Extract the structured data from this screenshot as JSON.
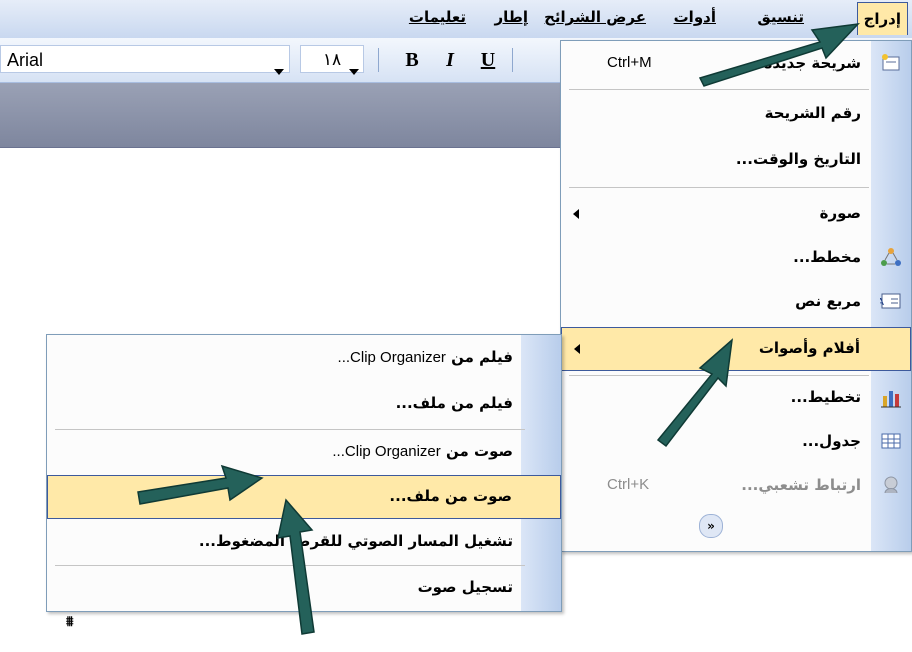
{
  "menubar": {
    "items": [
      {
        "label": "إدراج",
        "active": true
      },
      {
        "label": "تنسيق"
      },
      {
        "label": "أدوات"
      },
      {
        "label": "عرض الشرائح"
      },
      {
        "label": "إطار"
      },
      {
        "label": "تعليمات"
      }
    ]
  },
  "toolbar": {
    "font_name": "Arial",
    "font_size": "١٨",
    "bold_label": "B",
    "italic_label": "I",
    "underline_label": "U"
  },
  "insert_menu": {
    "items": [
      {
        "label": "شريحة جديدة",
        "shortcut": "Ctrl+M",
        "icon": "new-slide-icon"
      },
      {
        "label": "رقم الشريحة"
      },
      {
        "label": "التاريخ والوقت..."
      },
      {
        "label": "صورة",
        "has_submenu": true
      },
      {
        "label": "مخطط...",
        "icon": "diagram-icon"
      },
      {
        "label": "مربع نص",
        "icon": "textbox-icon"
      },
      {
        "label": "أفلام وأصوات",
        "has_submenu": true,
        "highlighted": true
      },
      {
        "label": "تخطيط...",
        "icon": "chart-icon"
      },
      {
        "label": "جدول...",
        "icon": "table-icon"
      },
      {
        "label": "ارتباط تشعبي...",
        "shortcut": "Ctrl+K",
        "icon": "hyperlink-icon",
        "disabled": true
      }
    ],
    "expand_icon": "chevron-double-down-icon"
  },
  "movies_submenu": {
    "items": [
      {
        "label_ar": "فيلم من",
        "label_en": "Clip Organizer..."
      },
      {
        "label_ar": "فيلم من ملف...",
        "label_en": ""
      },
      {
        "label_ar": "صوت من",
        "label_en": "Clip Organizer..."
      },
      {
        "label_ar": "صوت من ملف...",
        "label_en": "",
        "highlighted": true
      },
      {
        "label_ar": "تشغيل المسار الصوتي للقرص المضغوط...",
        "label_en": ""
      },
      {
        "label_ar": "تسجيل صوت",
        "label_en": ""
      }
    ]
  },
  "colors": {
    "highlight": "#ffe9a8",
    "highlight_border": "#3d5a9c",
    "annotation_arrow": "#24615a"
  }
}
